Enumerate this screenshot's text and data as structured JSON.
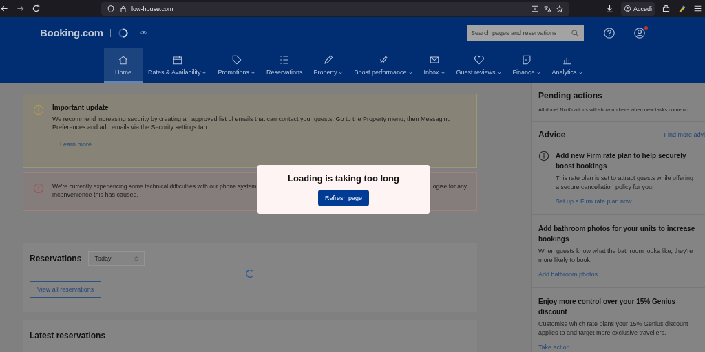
{
  "browser": {
    "url": "low-house.com",
    "account_label": "Accedi"
  },
  "header": {
    "logo": "Booking.com",
    "search": {
      "placeholder": "Search pages and reservations"
    },
    "has_notification": true
  },
  "nav": {
    "items": [
      {
        "label": "Home",
        "has_menu": false,
        "selected": true
      },
      {
        "label": "Rates & Availability",
        "has_menu": true,
        "selected": false
      },
      {
        "label": "Promotions",
        "has_menu": true,
        "selected": false
      },
      {
        "label": "Reservations",
        "has_menu": false,
        "selected": false
      },
      {
        "label": "Property",
        "has_menu": true,
        "selected": false
      },
      {
        "label": "Boost performance",
        "has_menu": true,
        "selected": false
      },
      {
        "label": "Inbox",
        "has_menu": true,
        "selected": false
      },
      {
        "label": "Guest reviews",
        "has_menu": true,
        "selected": false
      },
      {
        "label": "Finance",
        "has_menu": true,
        "selected": false
      },
      {
        "label": "Analytics",
        "has_menu": true,
        "selected": false
      }
    ]
  },
  "alerts": [
    {
      "kind": "warning",
      "title": "Important update",
      "text": "We recommend increasing security by creating an approved list of emails that can contact your guests. Go to the Property menu, then Messaging Preferences and add emails via the Security settings tab.",
      "link": "Learn more"
    },
    {
      "kind": "error",
      "line_1_start": "We're currently experiencing some technical difficulties with our phone system",
      "line_1_end": "ogise for any",
      "line_2": "inconvenience this has caused."
    }
  ],
  "modal": {
    "title": "Loading is taking too long",
    "button": "Refresh page"
  },
  "reservations": {
    "title": "Reservations",
    "period": "Today",
    "loading": true,
    "button": "View all reservations"
  },
  "latest_reservations": {
    "title": "Latest reservations"
  },
  "pending": {
    "title": "Pending actions",
    "text": "All done! Notifications will show up here when new tasks come up."
  },
  "advice": {
    "title": "Advice",
    "link": "Find more advi",
    "items": [
      {
        "has_icon": true,
        "title": "Add new Firm rate plan to help securely boost bookings",
        "text": "This rate plan is set to attract guests while offering a secure cancellation policy for you.",
        "link": "Set up a Firm rate plan now"
      },
      {
        "has_icon": false,
        "title": "Add bathroom photos for your units to increase bookings",
        "text": "When guests know what the bathroom looks like, they're more likely to book.",
        "link": "Add bathroom photos"
      },
      {
        "has_icon": false,
        "title": "Enjoy more control over your 15% Genius discount",
        "text": "Customise which rate plans your 15% Genius discount applies to and target more exclusive travellers.",
        "link": "Take action"
      }
    ]
  }
}
